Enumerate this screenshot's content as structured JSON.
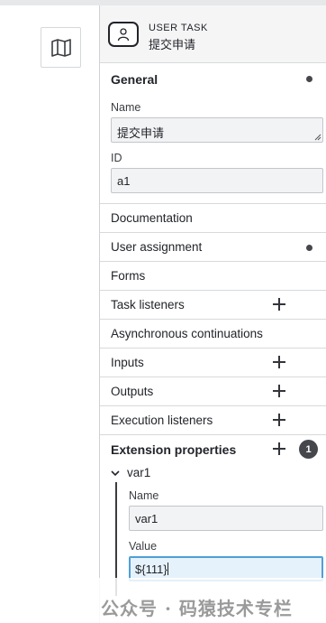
{
  "canvas": {
    "map_button_icon": "map-icon"
  },
  "header": {
    "type_label": "USER TASK",
    "element_name": "提交申请",
    "icon": "user-task-icon"
  },
  "general": {
    "title": "General",
    "name_label": "Name",
    "name_value": "提交申请",
    "id_label": "ID",
    "id_value": "a1"
  },
  "groups": {
    "documentation": "Documentation",
    "user_assignment": "User assignment",
    "forms": "Forms",
    "task_listeners": "Task listeners",
    "async_continuations": "Asynchronous continuations",
    "inputs": "Inputs",
    "outputs": "Outputs",
    "execution_listeners": "Execution listeners"
  },
  "extension": {
    "title": "Extension properties",
    "count": "1",
    "item_name": "var1",
    "name_label": "Name",
    "name_value": "var1",
    "value_label": "Value",
    "value_value": "${111}"
  },
  "watermark": "公众号 · 码猿技术专栏",
  "colors": {
    "accent_focus": "#4f9fd6",
    "badge": "#45474c",
    "header_bg": "#f5f5f6"
  }
}
